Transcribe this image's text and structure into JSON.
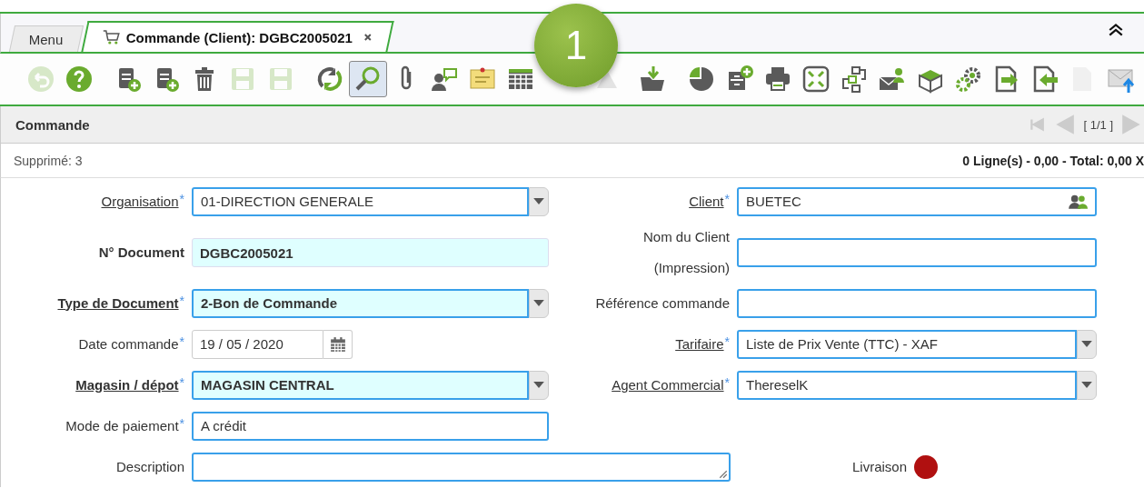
{
  "tabs": [
    {
      "label": "Menu",
      "selected": false,
      "kind": "menu"
    },
    {
      "label": "Commande (Client): DGBC2005021",
      "selected": true,
      "kind": "document",
      "closable": true
    }
  ],
  "callout": {
    "label": "1"
  },
  "toolbar": [
    {
      "kind": "undo",
      "disabled": true,
      "selected": false
    },
    {
      "kind": "help",
      "disabled": false,
      "selected": false
    },
    {
      "kind": "new",
      "disabled": false,
      "selected": false
    },
    {
      "kind": "copy",
      "disabled": false,
      "selected": false
    },
    {
      "kind": "delete",
      "disabled": false,
      "selected": false
    },
    {
      "kind": "save",
      "disabled": true,
      "selected": false
    },
    {
      "kind": "savecopy",
      "disabled": true,
      "selected": false
    },
    {
      "kind": "refresh",
      "disabled": false,
      "selected": false
    },
    {
      "kind": "find",
      "disabled": false,
      "selected": true
    },
    {
      "kind": "attach",
      "disabled": false,
      "selected": false
    },
    {
      "kind": "chat",
      "disabled": false,
      "selected": false
    },
    {
      "kind": "note",
      "disabled": false,
      "selected": false
    },
    {
      "kind": "grid",
      "disabled": false,
      "selected": false
    },
    {
      "kind": "report",
      "disabled": true,
      "selected": false
    },
    {
      "kind": "archive",
      "disabled": false,
      "selected": false
    },
    {
      "kind": "pie",
      "disabled": false,
      "selected": false
    },
    {
      "kind": "cabinet",
      "disabled": false,
      "selected": false
    },
    {
      "kind": "print",
      "disabled": false,
      "selected": false
    },
    {
      "kind": "expand",
      "disabled": false,
      "selected": false
    },
    {
      "kind": "workflow",
      "disabled": false,
      "selected": false
    },
    {
      "kind": "mailperson",
      "disabled": false,
      "selected": false
    },
    {
      "kind": "box",
      "disabled": false,
      "selected": false
    },
    {
      "kind": "gears",
      "disabled": false,
      "selected": false
    },
    {
      "kind": "export",
      "disabled": false,
      "selected": false
    },
    {
      "kind": "import",
      "disabled": false,
      "selected": false
    },
    {
      "kind": "doc",
      "disabled": true,
      "selected": false
    },
    {
      "kind": "mailup",
      "disabled": false,
      "selected": false
    }
  ],
  "panel": {
    "title": "Commande",
    "record_nav": "[ 1/1 ]"
  },
  "status_bar": {
    "left": "Supprimé: 3",
    "right": "0 Ligne(s) - 0,00 - Total: 0,00 X"
  },
  "rows": [
    {
      "left": {
        "label": "Organisation",
        "kind": "select",
        "value": "01-DIRECTION GENERALE",
        "required": "*",
        "link": true,
        "bold": false,
        "highlight": false
      },
      "right": {
        "label": "Client",
        "kind": "lookup",
        "value": "BUETEC",
        "required": "*",
        "link": true,
        "bold": false,
        "highlight": false
      }
    },
    {
      "left": {
        "label": "N° Document",
        "kind": "display",
        "value": "DGBC2005021",
        "link": false,
        "bold": true,
        "highlight": true
      },
      "right": {
        "label": "Nom du Client",
        "label_2": "(Impression)",
        "kind": "text",
        "link": false,
        "highlight": false
      }
    },
    {
      "left": {
        "label": "Type de Document",
        "kind": "select",
        "value": "2-Bon de Commande",
        "required": "*",
        "link": true,
        "bold": true,
        "highlight": true
      },
      "right": {
        "label": "Référence commande",
        "kind": "text",
        "link": false,
        "highlight": false
      }
    },
    {
      "left": {
        "label": "Date commande",
        "kind": "date",
        "value": "19 / 05 / 2020",
        "required": "*",
        "link": false,
        "bold": false
      },
      "right": {
        "label": "Tarifaire",
        "kind": "select",
        "value": "Liste de Prix Vente (TTC) - XAF",
        "required": "*",
        "link": true,
        "bold": false,
        "highlight": false
      }
    },
    {
      "left": {
        "label": "Magasin / dépot",
        "kind": "select",
        "value": "MAGASIN CENTRAL",
        "required": "*",
        "link": true,
        "bold": true,
        "highlight": true
      },
      "right": {
        "label": "Agent Commercial",
        "kind": "select",
        "value": "ThereselK",
        "required": "*",
        "link": true,
        "bold": false,
        "highlight": false
      }
    },
    {
      "left": {
        "label": "Mode de paiement",
        "kind": "text",
        "value": "A crédit",
        "required": "*",
        "link": false,
        "bold": false,
        "highlight": false
      }
    }
  ],
  "description": {
    "label": "Description"
  },
  "delivery": {
    "label": "Livraison",
    "color": "#b01010"
  }
}
